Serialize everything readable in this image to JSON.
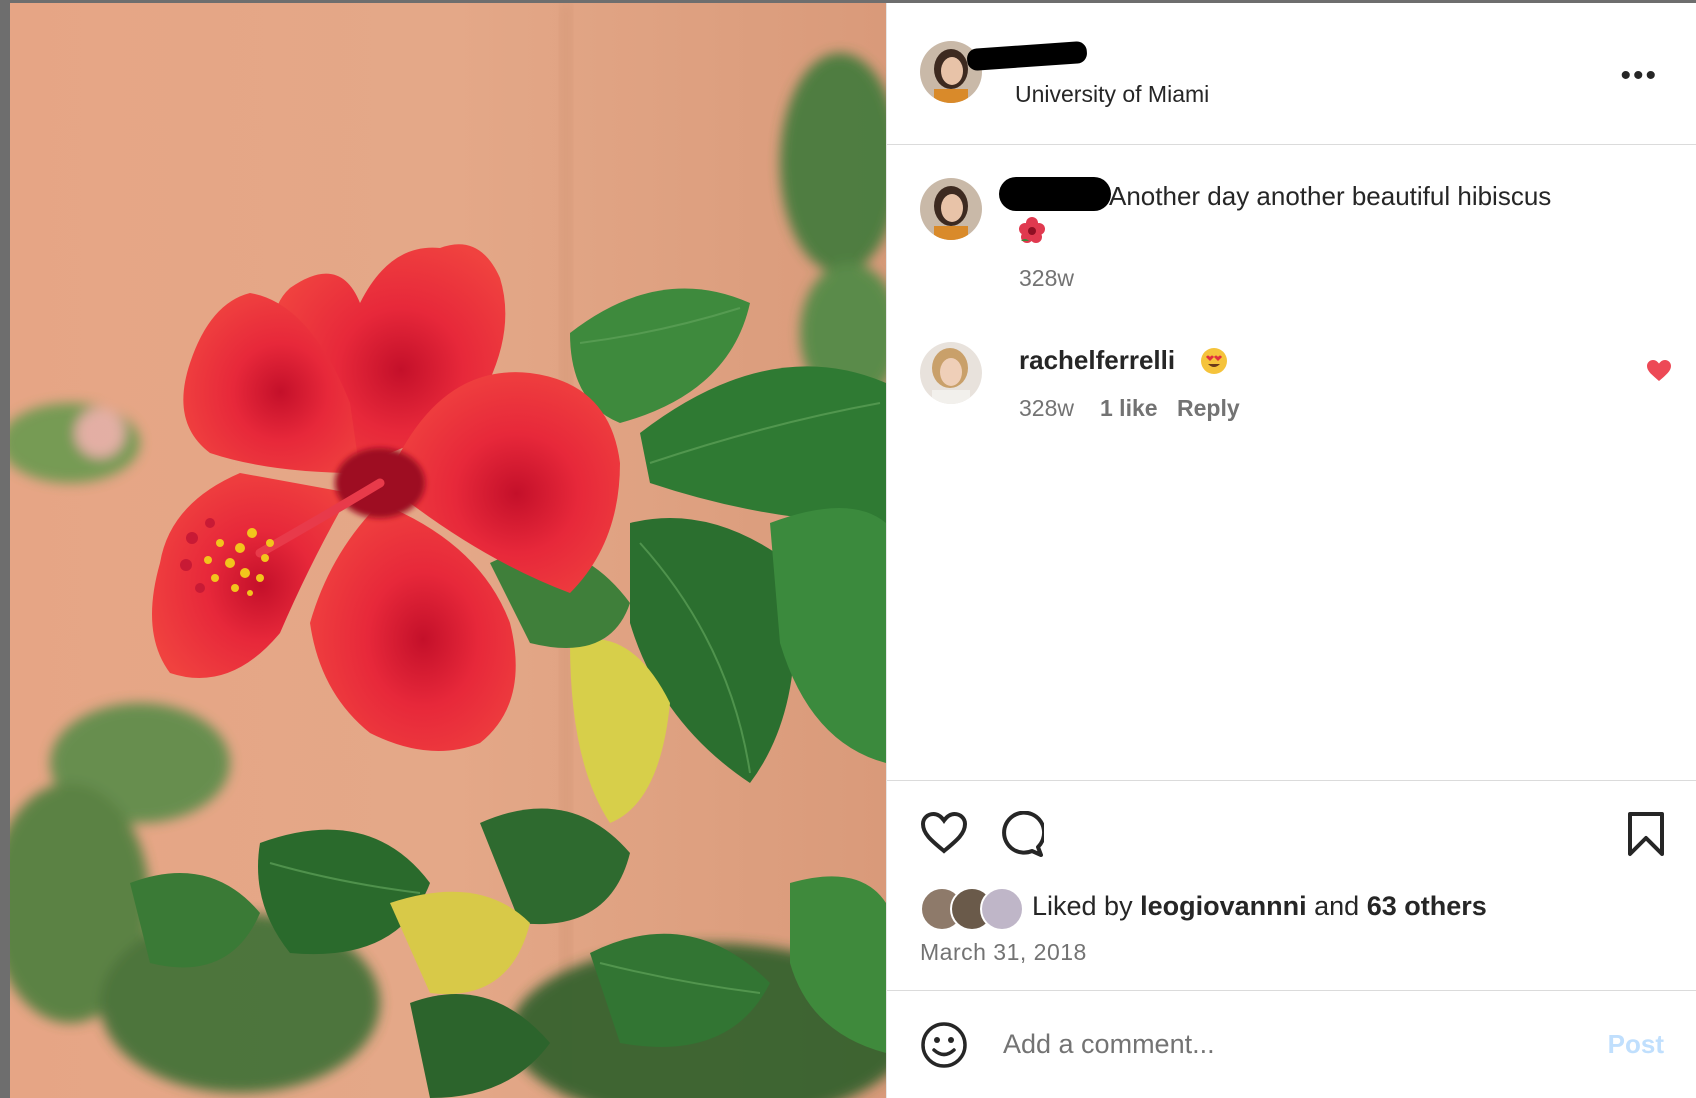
{
  "post": {
    "location": "University of Miami",
    "more_label": "•••"
  },
  "caption": {
    "text": "Another day another beautiful hibiscus",
    "emoji": "hibiscus-emoji",
    "time": "328w"
  },
  "comments": [
    {
      "username": "rachelferrelli",
      "emoji": "heart-eyes-emoji",
      "time": "328w",
      "likes": "1 like",
      "reply_label": "Reply",
      "liked": true
    }
  ],
  "likes": {
    "prefix": "Liked by",
    "user": "leogiovannni",
    "middle": "and",
    "others": "63 others"
  },
  "date": "March 31, 2018",
  "comment_box": {
    "placeholder": "Add a comment...",
    "post_label": "Post"
  },
  "colors": {
    "accent_red": "#ed4956",
    "post_disabled": "#c0dffd",
    "text_primary": "#262626",
    "text_secondary": "#737373"
  }
}
